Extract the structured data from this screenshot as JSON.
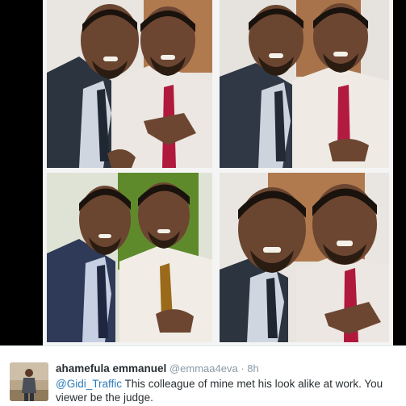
{
  "tweet": {
    "display_name": "ahamefula emmanuel",
    "handle": "@emmaa4eva",
    "separator": "·",
    "time": "8h",
    "mention": "@Gidi_Traffic",
    "text": " This colleague of mine met his look alike at work. You viewer be the judge."
  },
  "icons": {
    "avatar": "user-avatar-photo"
  }
}
